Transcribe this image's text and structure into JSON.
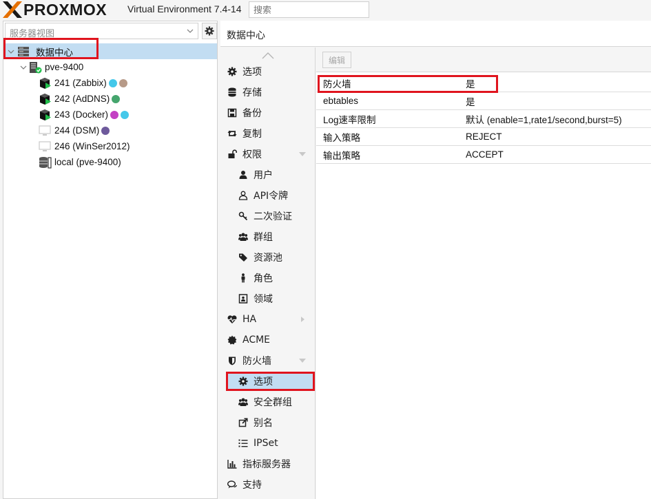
{
  "app": {
    "brand": "PROXMOX",
    "version": "Virtual Environment 7.4-14",
    "search_placeholder": "搜索"
  },
  "tree": {
    "view_selector": "服务器视图",
    "root": "数据中心",
    "node": "pve-9400",
    "items": [
      {
        "label": "241 (Zabbix)",
        "tags": [
          "#44c8ea",
          "#b79a88"
        ]
      },
      {
        "label": "242 (AdDNS)",
        "tags": [
          "#45a56d"
        ]
      },
      {
        "label": "243 (Docker)",
        "tags": [
          "#c340c3",
          "#44c8ea"
        ]
      },
      {
        "label": "244 (DSM)",
        "tags": [
          "#6e5a9c"
        ]
      },
      {
        "label": "246 (WinSer2012)",
        "tags": []
      },
      {
        "label": "local (pve-9400)",
        "tags": []
      }
    ]
  },
  "main": {
    "title": "数据中心",
    "toolbar": {
      "edit_label": "编辑"
    }
  },
  "nav": {
    "items": [
      {
        "label": "选项",
        "icon": "gear-icon"
      },
      {
        "label": "存储",
        "icon": "database-icon"
      },
      {
        "label": "备份",
        "icon": "floppy-icon"
      },
      {
        "label": "复制",
        "icon": "retweet-icon"
      },
      {
        "label": "权限",
        "icon": "unlock-icon"
      },
      {
        "label": "用户",
        "icon": "user-icon"
      },
      {
        "label": "API令牌",
        "icon": "user-outline-icon"
      },
      {
        "label": "二次验证",
        "icon": "key-icon"
      },
      {
        "label": "群组",
        "icon": "users-icon"
      },
      {
        "label": "资源池",
        "icon": "tags-icon"
      },
      {
        "label": "角色",
        "icon": "male-icon"
      },
      {
        "label": "领域",
        "icon": "address-book-icon"
      },
      {
        "label": "HA",
        "icon": "heartbeat-icon"
      },
      {
        "label": "ACME",
        "icon": "certificate-icon"
      },
      {
        "label": "防火墙",
        "icon": "shield-icon"
      },
      {
        "label": "选项",
        "icon": "gear-icon"
      },
      {
        "label": "安全群组",
        "icon": "users-icon"
      },
      {
        "label": "别名",
        "icon": "external-link-icon"
      },
      {
        "label": "IPSet",
        "icon": "list-ol-icon"
      },
      {
        "label": "指标服务器",
        "icon": "bar-chart-icon"
      },
      {
        "label": "支持",
        "icon": "comments-icon"
      }
    ]
  },
  "properties": [
    {
      "name": "防火墙",
      "value": "是"
    },
    {
      "name": "ebtables",
      "value": "是"
    },
    {
      "name": "Log速率限制",
      "value": "默认 (enable=1,rate1/second,burst=5)"
    },
    {
      "name": "输入策略",
      "value": "REJECT"
    },
    {
      "name": "输出策略",
      "value": "ACCEPT"
    }
  ],
  "colors": {
    "selection": "#c2ddf2",
    "highlight": "#e0141e",
    "logo_orange": "#e57000"
  }
}
